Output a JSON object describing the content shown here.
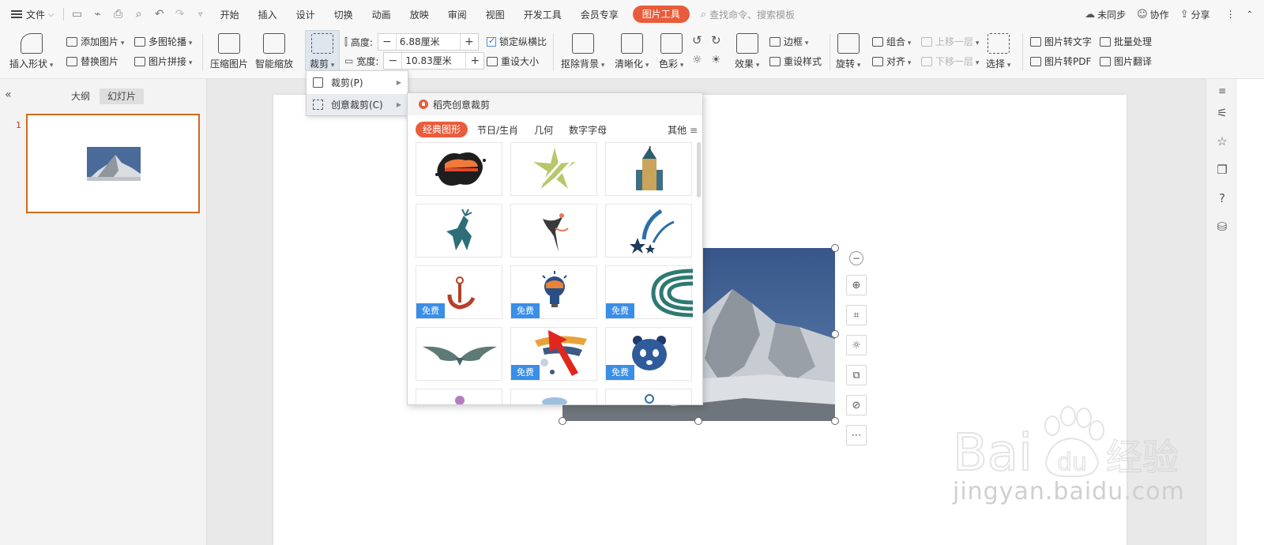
{
  "menubar": {
    "file_label": "文件",
    "tabs": [
      "开始",
      "插入",
      "设计",
      "切换",
      "动画",
      "放映",
      "审阅",
      "视图",
      "开发工具",
      "会员专享"
    ],
    "active_tab": "图片工具",
    "search_placeholder": "查找命令、搜索模板",
    "sync_label": "未同步",
    "collab_label": "协作",
    "share_label": "分享"
  },
  "ribbon": {
    "insert_shape": "插入形状",
    "add_image": "添加图片",
    "replace_image": "替换图片",
    "multi_carousel": "多图轮播",
    "image_stitch": "图片拼接",
    "compress": "压缩图片",
    "smart_zoom": "智能缩放",
    "crop": "裁剪",
    "height_label": "高度:",
    "height_value": "6.88厘米",
    "width_label": "宽度:",
    "width_value": "10.83厘米",
    "lock_ratio": "锁定纵横比",
    "reset_size": "重设大小",
    "remove_bg": "抠除背景",
    "sharpen": "清晰化",
    "color": "色彩",
    "effects": "效果",
    "border": "边框",
    "reset_style": "重设样式",
    "rotate": "旋转",
    "group": "组合",
    "align": "对齐",
    "bring_forward": "上移一层",
    "send_backward": "下移一层",
    "select": "选择",
    "img_to_text": "图片转文字",
    "img_to_pdf": "图片转PDF",
    "batch": "批量处理",
    "img_translate": "图片翻译"
  },
  "leftpanel": {
    "tab_outline": "大纲",
    "tab_slides": "幻灯片",
    "slide_number": "1"
  },
  "cropmenu": {
    "crop": "裁剪(P)",
    "creative_crop": "创意裁剪(C)"
  },
  "creative": {
    "title": "稻壳创意裁剪",
    "tabs": [
      "经典图形",
      "节日/生肖",
      "几何",
      "数字字母"
    ],
    "other": "其他",
    "free_label": "免费"
  },
  "watermark": {
    "url": "jingyan.baidu.com"
  },
  "colors": {
    "accent": "#e95c3b",
    "free_badge": "#3a8ee6",
    "sky": "#3f5f8f"
  }
}
